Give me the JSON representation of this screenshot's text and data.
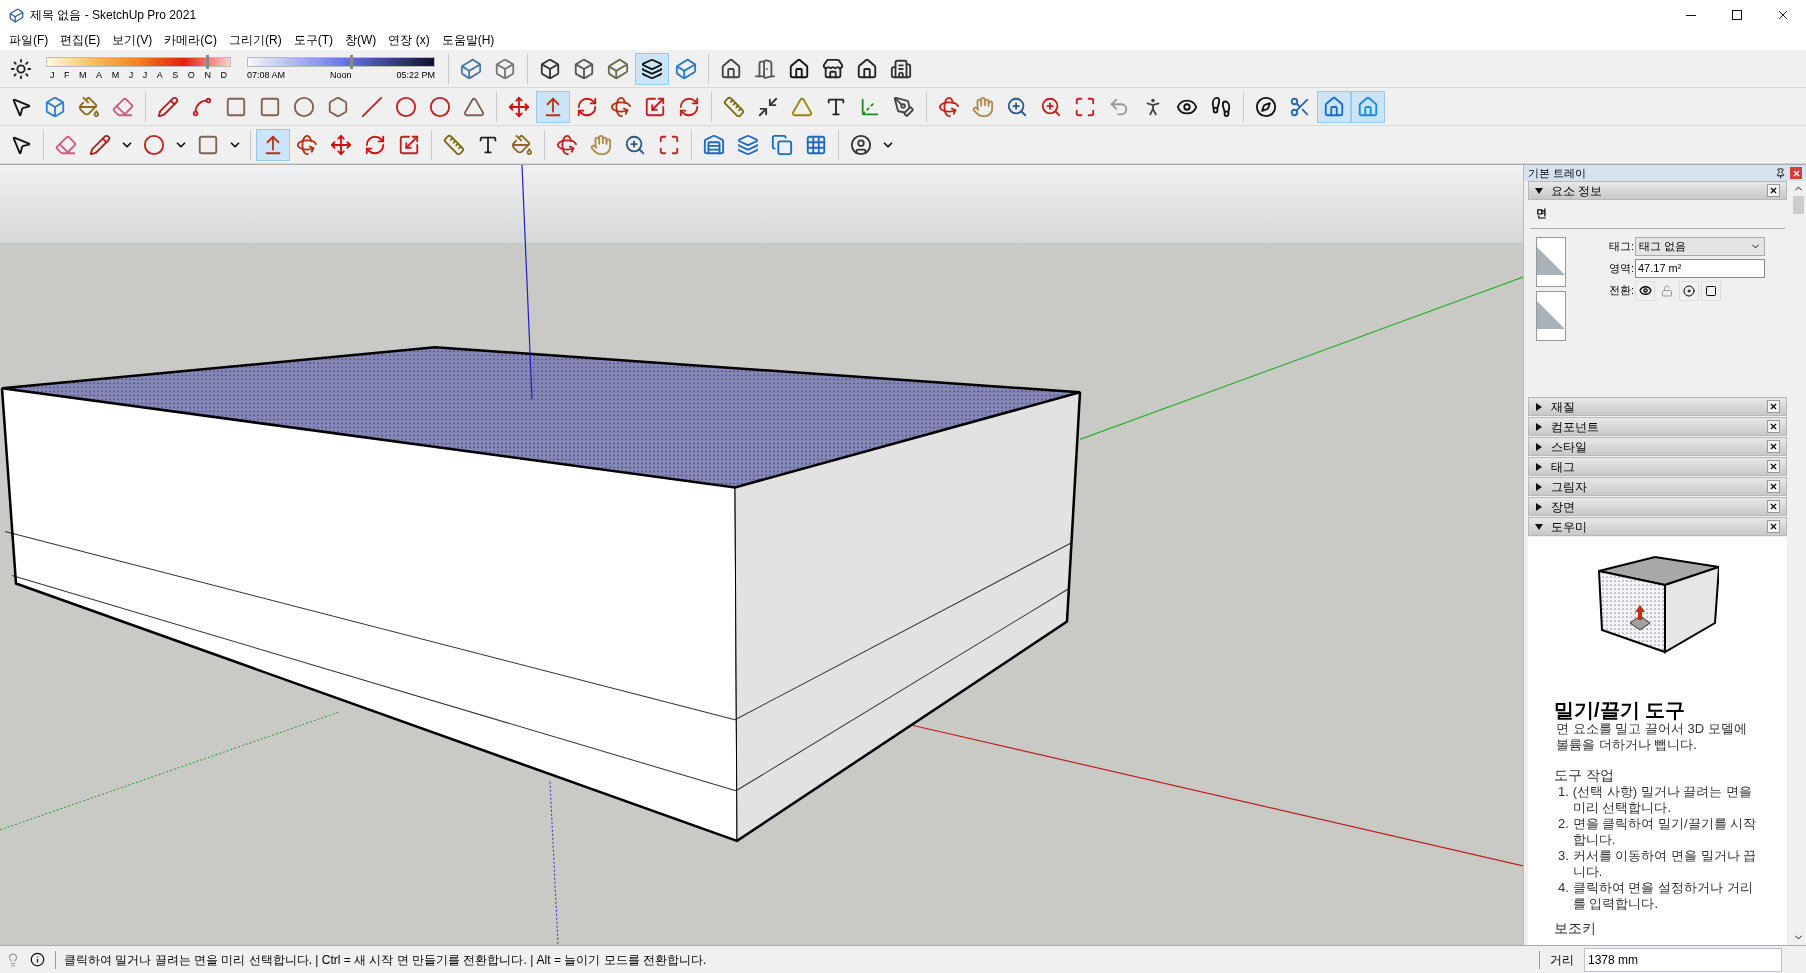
{
  "window": {
    "title": "제목 없음 - SketchUp Pro 2021"
  },
  "menu": [
    "파일(F)",
    "편집(E)",
    "보기(V)",
    "카메라(C)",
    "그리기(R)",
    "도구(T)",
    "창(W)",
    "연장 (x)",
    "도움말(H)"
  ],
  "shadow_settings": {
    "month_slider": {
      "labels": [
        "J",
        "F",
        "M",
        "A",
        "M",
        "J",
        "J",
        "A",
        "S",
        "O",
        "N",
        "D"
      ],
      "level": 0.87
    },
    "time_slider": {
      "labels": [
        "07:08 AM",
        "Noon",
        "05:22 PM"
      ],
      "level": 0.55
    }
  },
  "toolbars": [
    {
      "groups": [
        {
          "buttons": [
            {
              "selected": false
            }
          ]
        },
        {
          "buttons": [
            {
              "selected": false
            },
            {
              "selected": false
            }
          ]
        },
        {
          "buttons": [
            {
              "selected": false
            },
            {
              "selected": false
            },
            {
              "selected": false
            },
            {
              "selected": true
            },
            {
              "selected": false
            }
          ]
        },
        {
          "buttons": [
            {
              "selected": false
            },
            {
              "selected": false
            },
            {
              "selected": false
            },
            {
              "selected": false
            },
            {
              "selected": false
            },
            {
              "selected": false
            }
          ]
        }
      ]
    },
    {
      "groups": [
        {
          "buttons": [
            {
              "selected": false
            },
            {
              "selected": false
            },
            {
              "selected": false
            },
            {
              "selected": false
            }
          ]
        },
        {
          "buttons": [
            {
              "selected": false
            },
            {
              "selected": false
            },
            {
              "selected": false
            },
            {
              "selected": false
            },
            {
              "selected": false
            },
            {
              "selected": false
            },
            {
              "selected": false
            },
            {
              "selected": false
            },
            {
              "selected": false
            },
            {
              "selected": false
            }
          ]
        },
        {
          "buttons": [
            {
              "selected": false
            },
            {
              "selected": true
            },
            {
              "selected": false
            },
            {
              "selected": false
            },
            {
              "selected": false
            },
            {
              "selected": false
            }
          ]
        },
        {
          "buttons": [
            {
              "selected": false
            },
            {
              "selected": false
            },
            {
              "selected": false
            },
            {
              "selected": false
            },
            {
              "selected": false
            },
            {
              "selected": false
            }
          ]
        },
        {
          "buttons": [
            {
              "selected": false
            },
            {
              "selected": false
            },
            {
              "selected": false
            },
            {
              "selected": false
            },
            {
              "selected": false
            },
            {
              "selected": false
            },
            {
              "selected": false
            },
            {
              "selected": false
            },
            {
              "selected": false
            }
          ]
        },
        {
          "buttons": [
            {
              "selected": false
            },
            {
              "selected": false
            },
            {
              "selected": true
            },
            {
              "selected": true
            }
          ]
        }
      ]
    },
    {
      "groups": [
        {
          "buttons": [
            {
              "selected": false
            }
          ]
        },
        {
          "buttons": [
            {
              "selected": false
            },
            {
              "selected": false
            },
            {
              "selected": false
            },
            {
              "selected": false
            },
            {
              "selected": false
            },
            {
              "selected": false
            },
            {
              "selected": false
            }
          ]
        },
        {
          "buttons": [
            {
              "selected": true
            },
            {
              "selected": false
            },
            {
              "selected": false
            },
            {
              "selected": false
            },
            {
              "selected": false
            }
          ]
        },
        {
          "buttons": [
            {
              "selected": false
            },
            {
              "selected": false
            },
            {
              "selected": false
            }
          ]
        },
        {
          "buttons": [
            {
              "selected": false
            },
            {
              "selected": false
            },
            {
              "selected": false
            },
            {
              "selected": false
            }
          ]
        },
        {
          "buttons": [
            {
              "selected": false
            },
            {
              "selected": false
            },
            {
              "selected": false
            },
            {
              "selected": false
            }
          ]
        },
        {
          "buttons": [
            {
              "selected": false
            },
            {
              "selected": false
            }
          ]
        }
      ]
    }
  ],
  "tray": {
    "title": "기본 트레이",
    "entity_info": {
      "title": "요소 정보",
      "expanded": true,
      "entity": "면",
      "fields": [
        {
          "label": "태그:",
          "kind": "dropdown",
          "value": "태그 없음"
        },
        {
          "label": "영역:",
          "kind": "text",
          "value": "47.17 m²"
        },
        {
          "label": "전환:",
          "kind": "toggles"
        }
      ]
    },
    "panels": [
      {
        "title": "재질",
        "expanded": false
      },
      {
        "title": "컴포넌트",
        "expanded": false
      },
      {
        "title": "스타일",
        "expanded": false
      },
      {
        "title": "태그",
        "expanded": false
      },
      {
        "title": "그림자",
        "expanded": false
      },
      {
        "title": "장면",
        "expanded": false
      },
      {
        "title": "도우미",
        "expanded": true
      }
    ],
    "instructor": {
      "heading": "밀기/끌기 도구",
      "description": "면 요소를 밀고 끌어서 3D 모델에 볼륨을 더하거나 뺍니다.",
      "section": "도구 작업",
      "steps": [
        {
          "number": "1.",
          "text": "(선택 사항) 밀거나 끌려는 면을 미리 선택합니다."
        },
        {
          "number": "2.",
          "text": "면을 클릭하여 밀기/끌기를 시작합니다."
        },
        {
          "number": "3.",
          "text": "커서를 이동하여 면을 밀거나 끕니다."
        },
        {
          "number": "4.",
          "text": "클릭하여 면을 설정하거나 거리를 입력합니다."
        }
      ],
      "section_2": "보조키"
    }
  },
  "status_bar": {
    "message": "클릭하여 밀거나 끌려는 면을 미리 선택합니다. | Ctrl = 새 시작 면 만들기를 전환합니다. | Alt = 늘이기 모드를 전환합니다.",
    "measurement_label": "거리",
    "measurement_value": "1378 mm"
  }
}
